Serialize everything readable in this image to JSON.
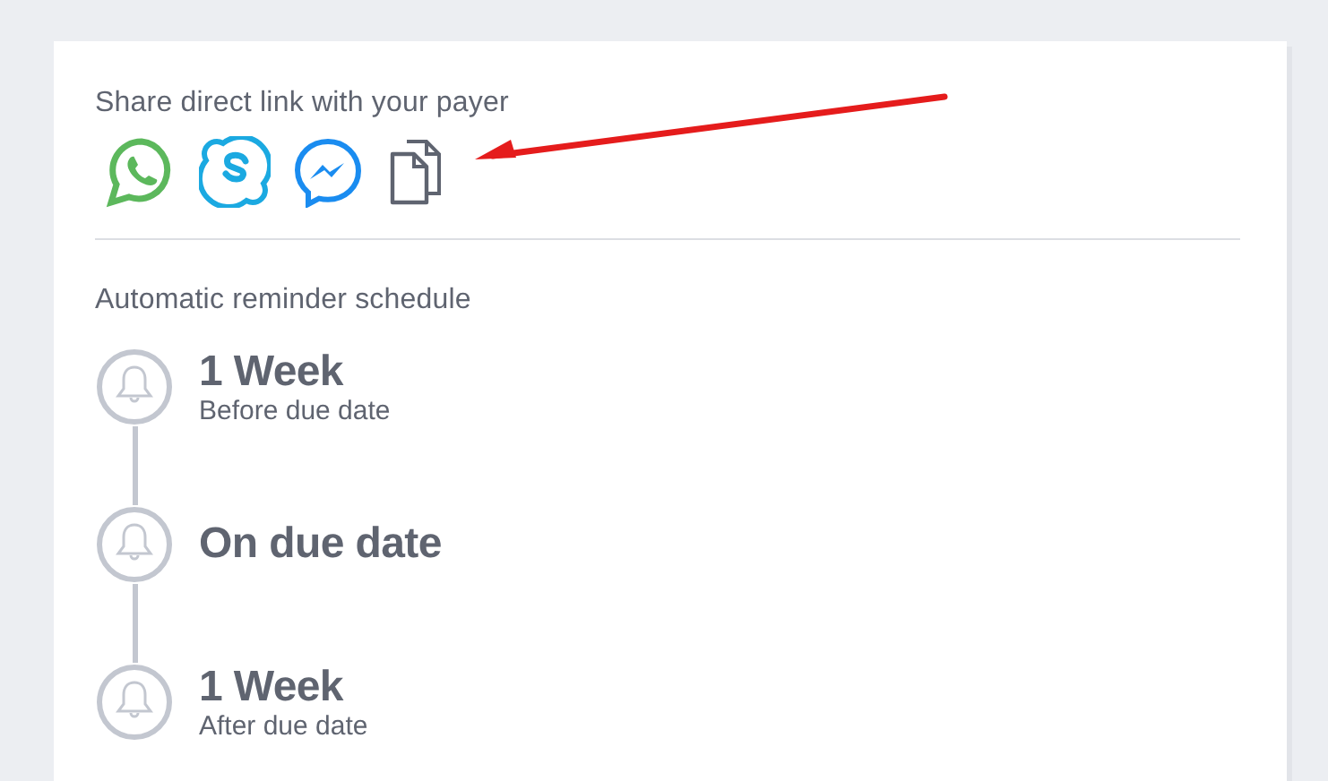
{
  "share": {
    "heading": "Share direct link with your payer",
    "icons": [
      {
        "kind": "whatsapp"
      },
      {
        "kind": "skype"
      },
      {
        "kind": "messenger"
      },
      {
        "kind": "copy"
      }
    ]
  },
  "reminders": {
    "heading": "Automatic reminder schedule",
    "items": [
      {
        "title": "1 Week",
        "subtitle": "Before due date"
      },
      {
        "title": "On due date"
      },
      {
        "title": "1 Week",
        "subtitle": "After due date"
      }
    ]
  }
}
